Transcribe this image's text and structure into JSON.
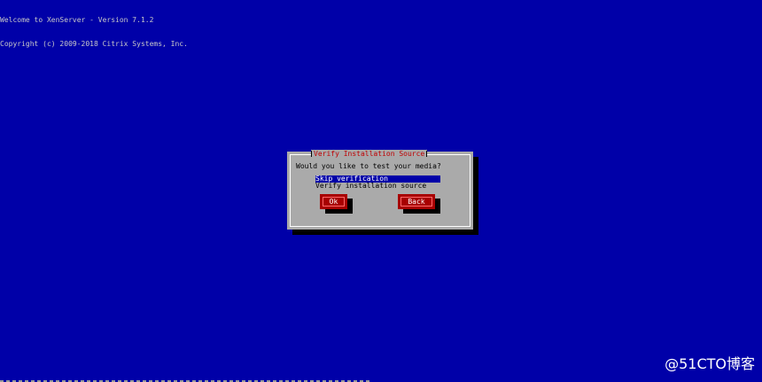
{
  "console": {
    "line1": "Welcome to XenServer - Version 7.1.2",
    "line2": "Copyright (c) 2009-2018 Citrix Systems, Inc."
  },
  "dialog": {
    "title": "Verify Installation Source",
    "question": "Would you like to test your media?",
    "options": [
      {
        "label": "Skip verification",
        "selected": true
      },
      {
        "label": "Verify installation source",
        "selected": false
      }
    ],
    "ok_label": "Ok",
    "back_label": "Back"
  },
  "watermark": "@51CTO博客",
  "colors": {
    "background": "#0000a8",
    "dialog": "#aaaaaa",
    "button": "#a80000",
    "title_text": "#c00000",
    "selection": "#0000a8"
  }
}
